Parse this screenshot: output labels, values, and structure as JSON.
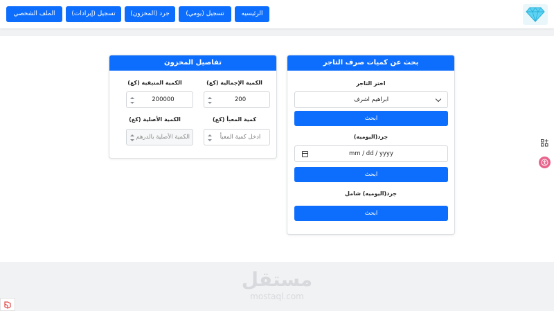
{
  "nav": {
    "home": "الرئيسيه",
    "daily_entry": "تسجيل (يومي)",
    "inventory_count": "جرد (المخزون)",
    "revenue_entry": "تسجيل (إيرادات)",
    "profile": "الملف الشخصي"
  },
  "search_card": {
    "title": "بحث عن كميات صرف التاجر",
    "merchant_label": "اختر التاجر",
    "merchant_selected": "ابراهيم اشرف",
    "search_btn_1": "ابحث",
    "daily_label": "جرد(اليوميه)",
    "date_placeholder": "mm / dd / yyyy",
    "search_btn_2": "ابحث",
    "daily_full_label": "جرد(اليوميه) شامل",
    "search_btn_3": "ابحث"
  },
  "inventory_card": {
    "title": "تفاصيل المخزون",
    "total_qty_label": "الكمية الإجمالية (كغ)",
    "total_qty_value": "200",
    "remaining_qty_label": "الكمية المتبقية (كغ)",
    "remaining_qty_value": "200000",
    "packed_qty_label": "كمية المعبأ (كغ)",
    "packed_qty_placeholder": "ادخل كمية المعبأ",
    "original_qty_label": "الكمية الأصلية (كغ)",
    "original_qty_placeholder": "الكمية الأصلية بالدرهم"
  },
  "watermark": {
    "arabic": "مستقل",
    "latin": "mostaql.com"
  },
  "colors": {
    "primary": "#0d6efd",
    "page_bg": "#f1f2f4"
  }
}
